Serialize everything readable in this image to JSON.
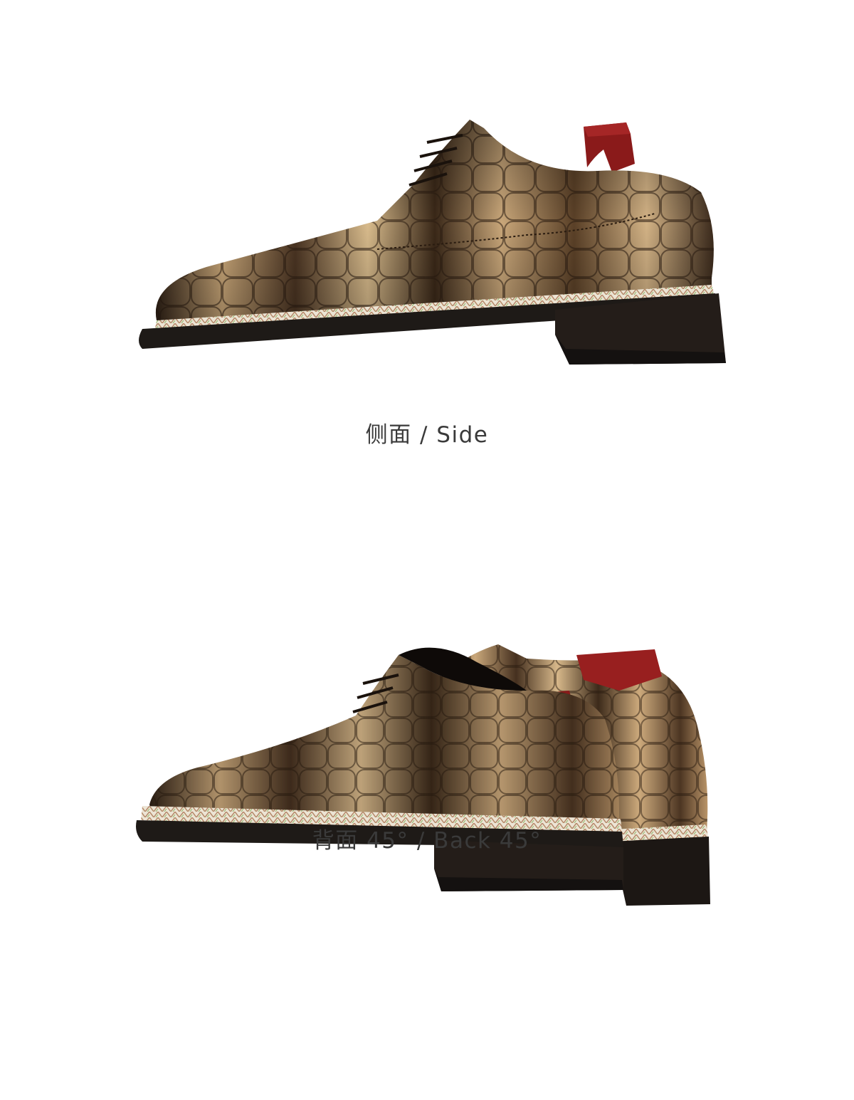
{
  "views": [
    {
      "caption": "侧面 / Side"
    },
    {
      "caption": "背面 45° / Back 45°"
    }
  ],
  "colors": {
    "background": "#ffffff",
    "caption_text": "#3a3a3a",
    "sole": "#1e1a17",
    "leather_dark": "#3b2a1c",
    "leather_light": "#c9a77a",
    "shoe_tree": "#8a1a1a"
  }
}
